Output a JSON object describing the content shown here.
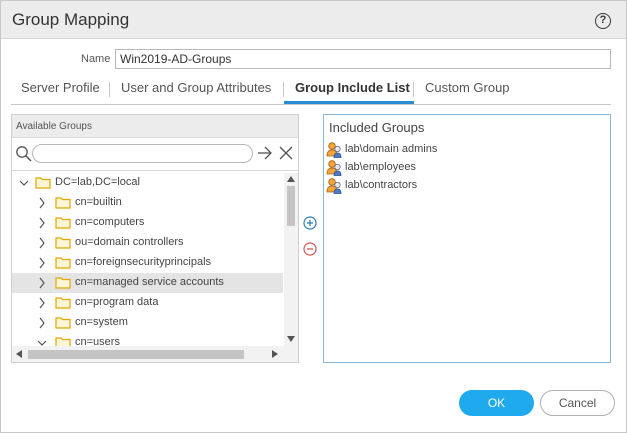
{
  "dialog": {
    "title": "Group Mapping",
    "help_label": "?"
  },
  "name_field": {
    "label": "Name",
    "value": "Win2019-AD-Groups"
  },
  "tabs": [
    {
      "label": "Server Profile"
    },
    {
      "label": "User and Group Attributes"
    },
    {
      "label": "Group Include List"
    },
    {
      "label": "Custom Group"
    }
  ],
  "active_tab": "Group Include List",
  "available_groups": {
    "header": "Available Groups",
    "search_value": "",
    "tree": [
      {
        "label": "DC=lab,DC=local",
        "expanded": true,
        "selected": false
      },
      {
        "label": "cn=builtin",
        "expanded": false,
        "selected": false
      },
      {
        "label": "cn=computers",
        "expanded": false,
        "selected": false
      },
      {
        "label": "ou=domain controllers",
        "expanded": false,
        "selected": false
      },
      {
        "label": "cn=foreignsecurityprincipals",
        "expanded": false,
        "selected": false
      },
      {
        "label": "cn=managed service accounts",
        "expanded": false,
        "selected": true
      },
      {
        "label": "cn=program data",
        "expanded": false,
        "selected": false
      },
      {
        "label": "cn=system",
        "expanded": false,
        "selected": false
      },
      {
        "label": "cn=users",
        "expanded": true,
        "selected": false
      }
    ]
  },
  "included_groups": {
    "header": "Included Groups",
    "items": [
      {
        "label": "lab\\domain admins"
      },
      {
        "label": "lab\\employees"
      },
      {
        "label": "lab\\contractors"
      }
    ]
  },
  "buttons": {
    "ok": "OK",
    "cancel": "Cancel"
  },
  "colors": {
    "accent": "#2a8dd4",
    "ok_button": "#1eaaed",
    "folder": "#f0c232",
    "add": "#2a7fb8",
    "remove": "#d9534f"
  },
  "icons": {
    "help": "help-circle-icon",
    "search": "search-icon",
    "go": "arrow-right-icon",
    "clear": "close-icon",
    "folder": "folder-icon",
    "user_group": "user-group-icon",
    "add": "plus-circle-icon",
    "remove": "minus-circle-icon"
  }
}
